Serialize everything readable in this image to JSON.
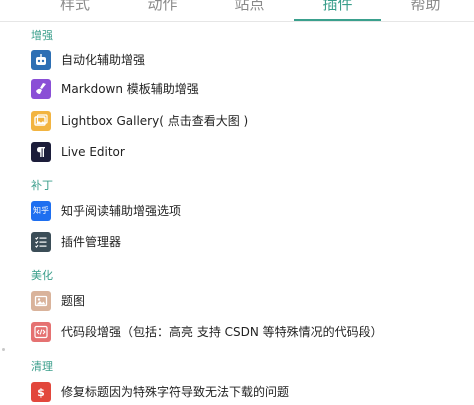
{
  "tabs": [
    {
      "label": "样式"
    },
    {
      "label": "动作"
    },
    {
      "label": "站点"
    },
    {
      "label": "插件"
    },
    {
      "label": "帮助"
    }
  ],
  "active_tab": "插件",
  "accent_color": "#3a9e8b",
  "sections": [
    {
      "title": "增强",
      "items": [
        {
          "label": "自动化辅助增强",
          "icon": "robot-icon",
          "color": "#2d6fb4"
        },
        {
          "label": "Markdown 模板辅助增强",
          "icon": "broom-icon",
          "color": "#8a4fd6"
        },
        {
          "label": "Lightbox Gallery( 点击查看大图 )",
          "icon": "gallery-icon",
          "color": "#f2b441"
        },
        {
          "label": "Live Editor",
          "icon": "pilcrow-icon",
          "color": "#1c1d3a"
        }
      ]
    },
    {
      "title": "补丁",
      "items": [
        {
          "label": "知乎阅读辅助增强选项",
          "icon": "zhihu-icon",
          "icon_text": "知乎",
          "color": "#1e6ff0"
        },
        {
          "label": "插件管理器",
          "icon": "checklist-icon",
          "color": "#3b4d57"
        }
      ]
    },
    {
      "title": "美化",
      "items": [
        {
          "label": "题图",
          "icon": "image-icon",
          "color": "#d9b39b"
        },
        {
          "label": "代码段增强（包括：高亮 支持 CSDN 等特殊情况的代码段）",
          "icon": "code-icon",
          "color": "#e57272"
        }
      ]
    },
    {
      "title": "清理",
      "items": [
        {
          "label": "修复标题因为特殊字符导致无法下载的问题",
          "icon": "dollar-icon",
          "color": "#e2473c"
        }
      ]
    }
  ]
}
